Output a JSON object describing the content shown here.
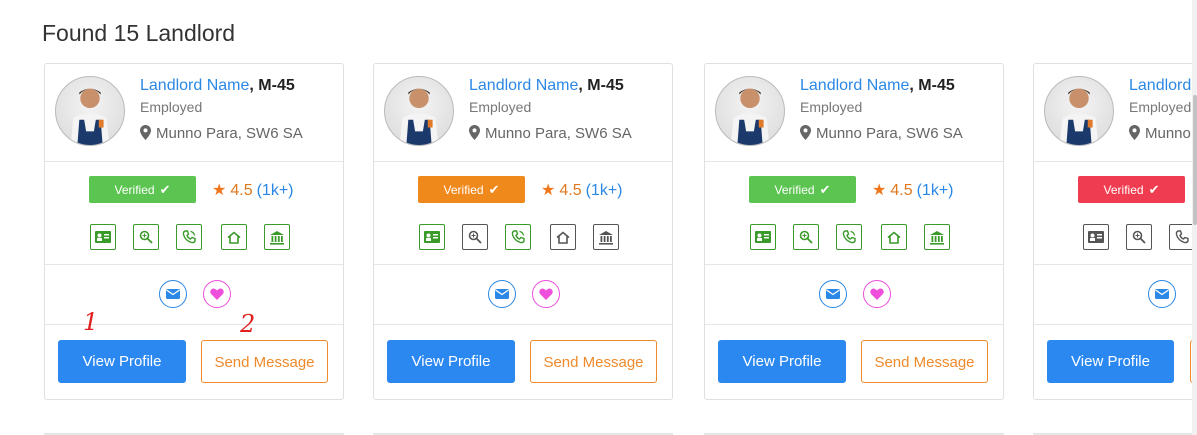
{
  "heading": "Found 15 Landlord",
  "colors": {
    "green": "#5cc450",
    "orange": "#f0891c",
    "red": "#f03c50",
    "blue": "#2b88e6",
    "pink": "#ee4fdb",
    "icon_green": "#3a9a2a",
    "icon_gray": "#555555"
  },
  "cards": [
    {
      "name": "Landlord Name",
      "code": ", M-45",
      "status": "Employed",
      "location": "Munno Para, SW6 SA",
      "badge": "Verified",
      "badge_color": "#5cc450",
      "rating": "4.5",
      "reviews": "(1k+)",
      "primary_btn": "View Profile",
      "secondary_btn": "Send Message",
      "icon_color": "green"
    },
    {
      "name": "Landlord Name",
      "code": ", M-45",
      "status": "Employed",
      "location": "Munno Para, SW6 SA",
      "badge": "Verified",
      "badge_color": "#f0891c",
      "rating": "4.5",
      "reviews": "(1k+)",
      "primary_btn": "View Profile",
      "secondary_btn": "Send Message",
      "icon_color": "mixed"
    },
    {
      "name": "Landlord Name",
      "code": ", M-45",
      "status": "Employed",
      "location": "Munno Para, SW6 SA",
      "badge": "Verified",
      "badge_color": "#5cc450",
      "rating": "4.5",
      "reviews": "(1k+)",
      "primary_btn": "View Profile",
      "secondary_btn": "Send Message",
      "icon_color": "green"
    },
    {
      "name": "Landlord",
      "code": "",
      "status": "Employed",
      "location": "Munno",
      "badge": "Verified",
      "badge_color": "#f03c50",
      "rating": "",
      "reviews": "",
      "primary_btn": "View Profile",
      "secondary_btn": "",
      "icon_color": "gray"
    }
  ],
  "annotations": [
    "1",
    "2"
  ],
  "icons": [
    "id-card-icon",
    "search-icon",
    "phone-icon",
    "home-icon",
    "bank-icon"
  ],
  "contact_icons": [
    "email-icon",
    "heart-icon"
  ]
}
